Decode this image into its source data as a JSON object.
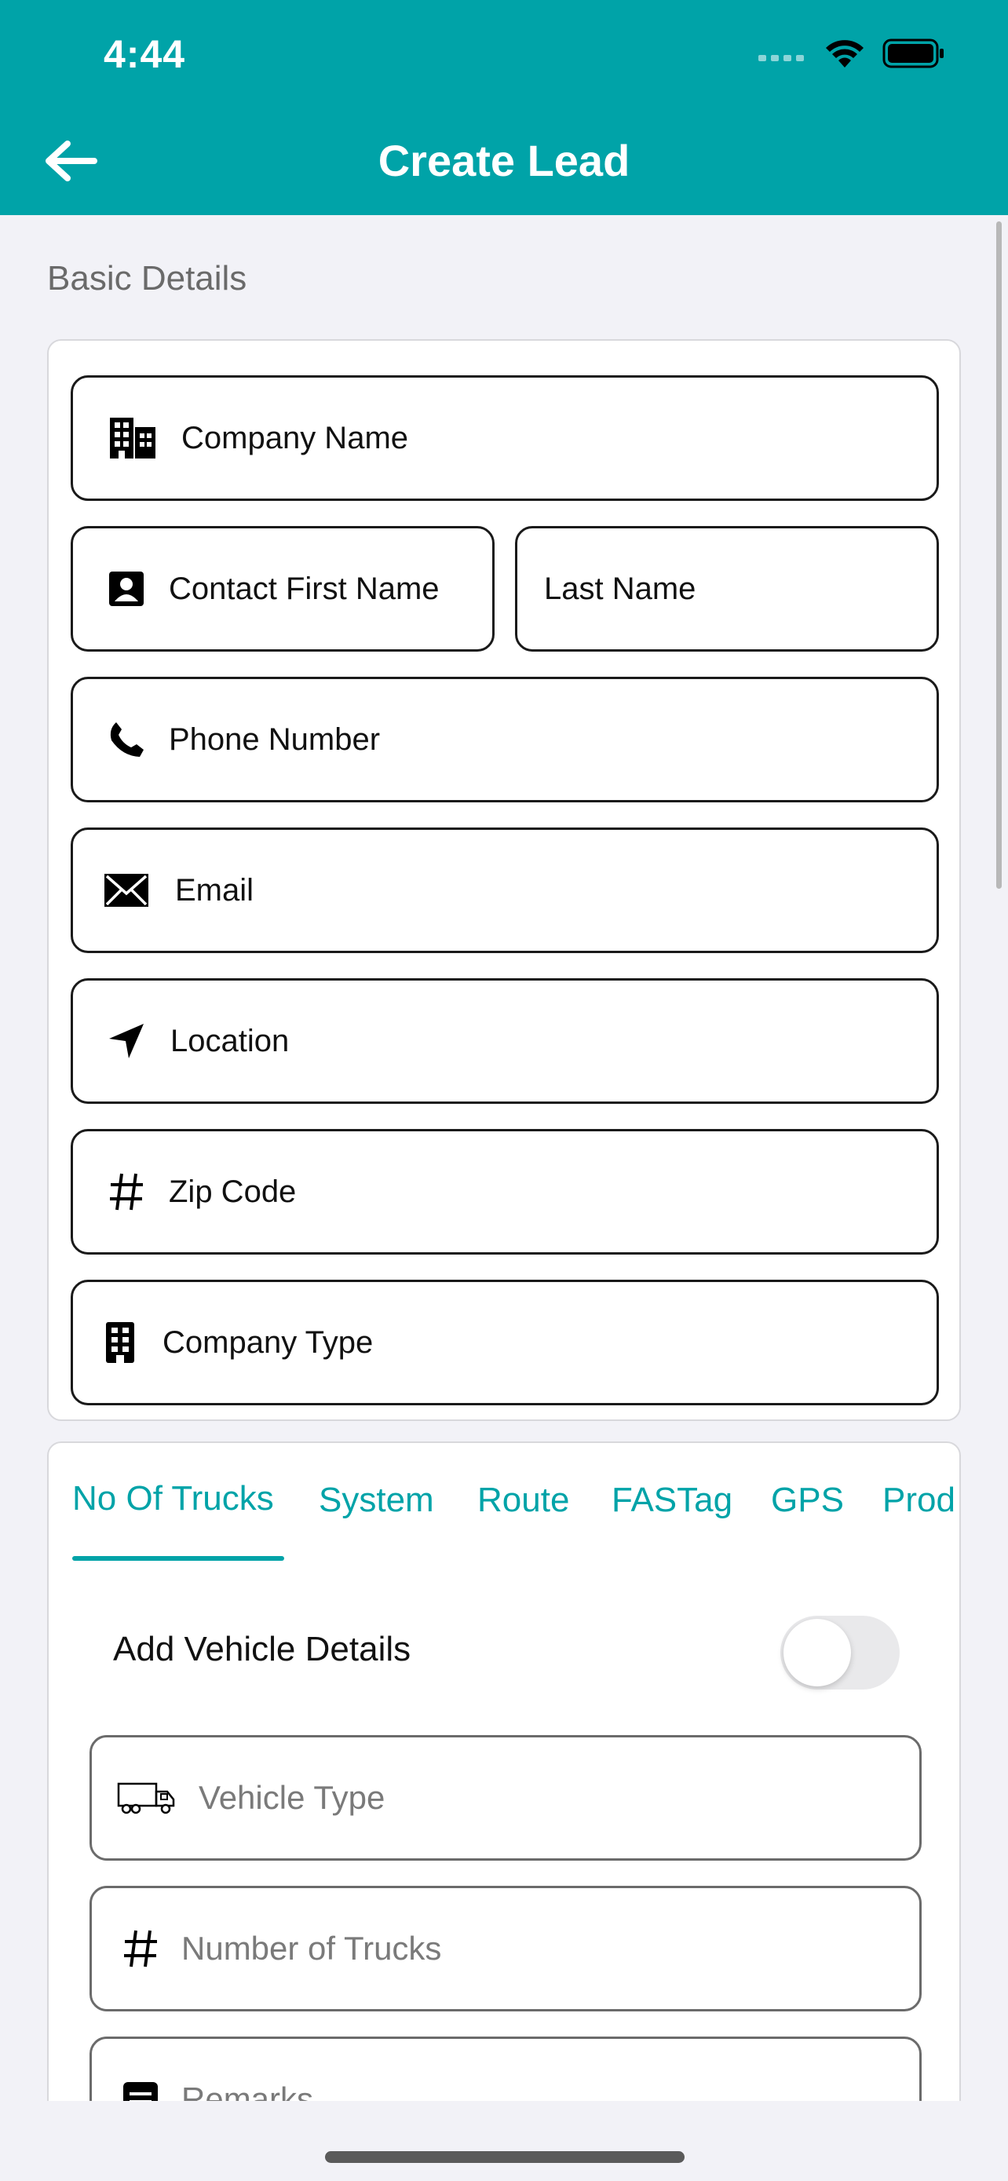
{
  "status_bar": {
    "time": "4:44"
  },
  "nav": {
    "title": "Create Lead"
  },
  "basic": {
    "section_title": "Basic Details",
    "company_name": "Company Name",
    "first_name": "Contact First Name",
    "last_name": "Last Name",
    "phone": "Phone Number",
    "email": "Email",
    "location": "Location",
    "zip": "Zip Code",
    "company_type": "Company Type"
  },
  "tabs": [
    {
      "label": "No Of Trucks",
      "active": true
    },
    {
      "label": "System"
    },
    {
      "label": "Route"
    },
    {
      "label": "FASTag"
    },
    {
      "label": "GPS"
    },
    {
      "label": "Prod"
    }
  ],
  "vehicle": {
    "toggle_label": "Add Vehicle Details",
    "toggle_on": false,
    "vehicle_type_placeholder": "Vehicle Type",
    "number_of_trucks_placeholder": "Number of Trucks",
    "remarks_placeholder": "Remarks"
  },
  "colors": {
    "primary": "#00a3a8",
    "background": "#f2f2f7"
  }
}
